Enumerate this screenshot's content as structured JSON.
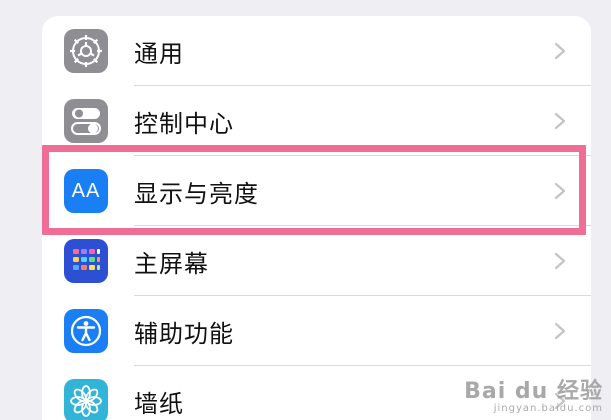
{
  "settings": {
    "items": [
      {
        "label": "通用",
        "icon": "gear-icon",
        "color": "#8e8e93"
      },
      {
        "label": "控制中心",
        "icon": "toggle-switches-icon",
        "color": "#8e8e93"
      },
      {
        "label": "显示与亮度",
        "icon": "text-size-icon",
        "icon_text": "AA",
        "color": "#1a7ff5"
      },
      {
        "label": "主屏幕",
        "icon": "home-screen-grid-icon",
        "color": "#2c4fd4"
      },
      {
        "label": "辅助功能",
        "icon": "accessibility-person-icon",
        "color": "#1a7ff5"
      },
      {
        "label": "墙纸",
        "icon": "flower-icon",
        "color": "#32b4d8"
      }
    ]
  },
  "highlight": {
    "target": "显示与亮度",
    "color": "#f06e96"
  },
  "watermark": {
    "main": "Bai du 经验",
    "sub": "jingyan.baidu.com"
  }
}
